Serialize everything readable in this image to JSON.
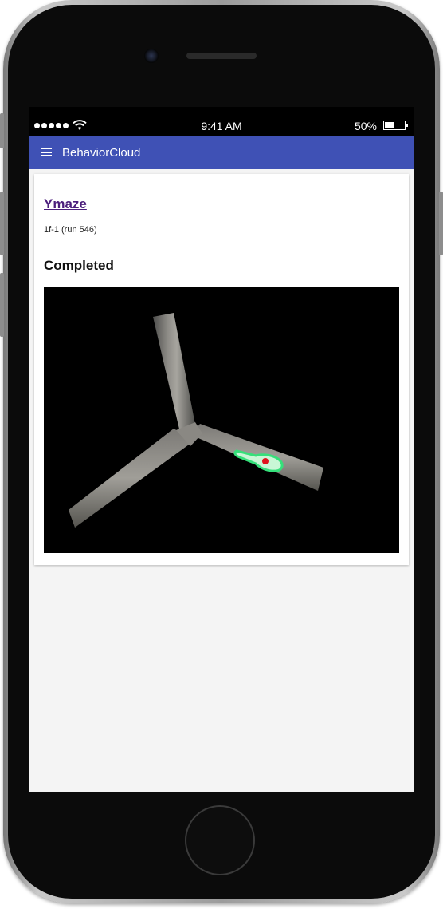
{
  "status_bar": {
    "time": "9:41 AM",
    "battery_percent": "50%",
    "battery_level": 0.5
  },
  "app_bar": {
    "title": "BehaviorCloud",
    "menu_icon": "hamburger-menu-icon"
  },
  "experiment": {
    "title": "Ymaze",
    "subtitle": "1f-1 (run 546)",
    "status": "Completed"
  },
  "colors": {
    "app_bar": "#3f51b5",
    "title_link": "#4b1e7c",
    "tracking_outline": "#35e07a",
    "tracking_point": "#e0141e"
  }
}
